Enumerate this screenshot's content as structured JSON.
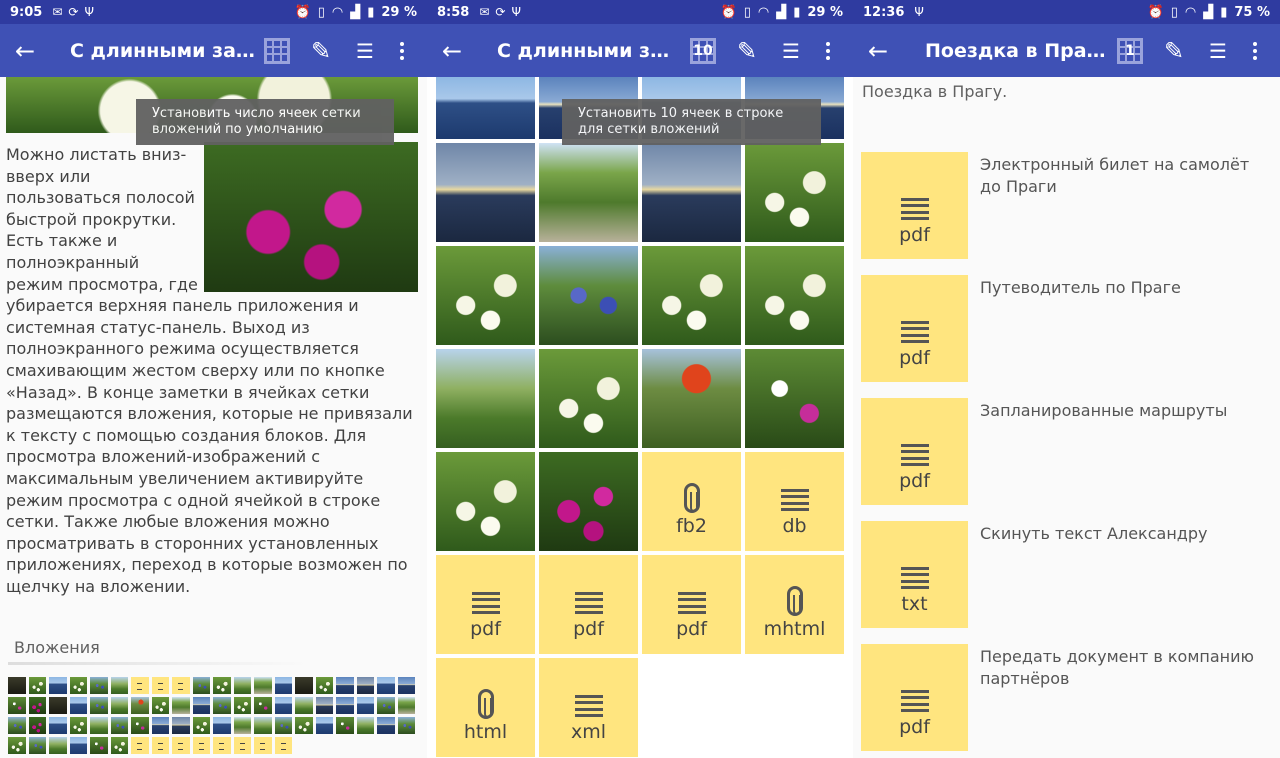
{
  "screens": [
    {
      "status": {
        "time": "9:05",
        "battery": "29 %"
      },
      "title": "С длинными зам...",
      "tooltip": "Установить число ячеек сетки вложений по умолчанию",
      "text": "Можно листать вниз-вверх или пользоваться полосой быстрой прокрутки. Есть также и полноэкранный режим просмотра, где убирается верхняя панель приложения и системная статус-панель. Выход из полноэкранного режима осуществляется смахивающим жестом сверху или по кнопке «Назад». В конце заметки в ячейках сетки размещаются вложения, которые не привязали к тексту с помощью создания блоков. Для просмотра вложений-изображений с максимальным увеличением активируйте режим просмотра с одной ячейкой в строке сетки. Также любые вложения можно просматривать в сторонних установленных приложениях, переход в которые возможен по щелчку на вложении.",
      "attachments_title": "Вложения"
    },
    {
      "status": {
        "time": "8:58",
        "battery": "29 %"
      },
      "title": "С длинными за...",
      "grid_count": "10",
      "tooltip": "Установить 10 ячеек в строке для сетки вложений",
      "files": [
        "fb2",
        "db",
        "pdf",
        "pdf",
        "pdf",
        "mhtml",
        "html",
        "xml"
      ]
    },
    {
      "status": {
        "time": "12:36",
        "battery": "75 %"
      },
      "title": "Поездка в Прагу.",
      "grid_count": "1",
      "heading": "Поездка в Прагу.",
      "items": [
        {
          "label": "Электронный билет на самолёт до Праги",
          "type": "pdf"
        },
        {
          "label": "Путеводитель по Праге",
          "type": "pdf"
        },
        {
          "label": "Запланированные маршруты",
          "type": "pdf"
        },
        {
          "label": "Скинуть текст Александру",
          "type": "txt"
        },
        {
          "label": "Передать документ в компанию партнёров",
          "type": "pdf"
        }
      ]
    }
  ],
  "colors": {
    "statusbar": "#2f3ba0",
    "appbar": "#3f51b5",
    "file_tile": "#ffe57f"
  }
}
